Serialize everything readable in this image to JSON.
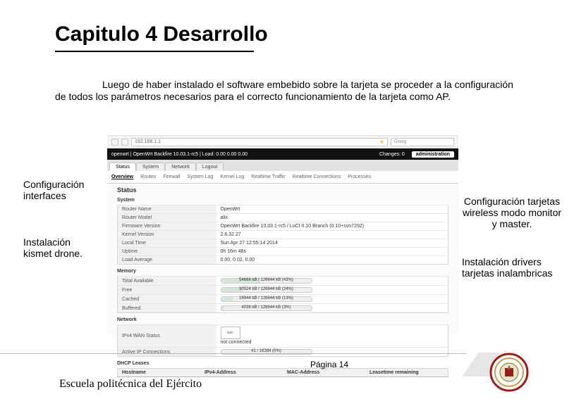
{
  "title": "Capitulo 4  Desarrollo",
  "paragraph": "Luego de haber instalado el software embebido sobre la tarjeta se proceder a la configuración de todos los parámetros necesarios para el correcto funcionamiento de la tarjeta como AP.",
  "annotations": {
    "left1": "Configuración interfaces",
    "left2": "Instalación kismet drone.",
    "right1": "Configuración tarjetas wireless modo monitor y master.",
    "right2": "Instalación drivers tarjetas inalambricas"
  },
  "browser": {
    "address": "192.168.1.1",
    "search_placeholder": "Goog"
  },
  "admin": {
    "brand": "openwrt | OpenWrt Backfire 10.03.1-rc5 | Load: 0.00 0.00 0.00",
    "changes": "Changes: 0",
    "admin_label": "administration"
  },
  "tabs": {
    "main": [
      "Status",
      "System",
      "Network",
      "Logout"
    ],
    "sub": [
      "Overview",
      "Routes",
      "Firewall",
      "System Log",
      "Kernel Log",
      "Realtime Traffic",
      "Realtime Connections",
      "Processes"
    ]
  },
  "status": {
    "heading": "Status",
    "system_heading": "System",
    "system": [
      {
        "k": "Router Name",
        "v": "OpenWrt"
      },
      {
        "k": "Router Model",
        "v": "alix"
      },
      {
        "k": "Firmware Version",
        "v": "OpenWrt Backfire 10.03.1-rc5 / LuCI 0.10 Branch (0.10+svn7292)"
      },
      {
        "k": "Kernel Version",
        "v": "2.6.32.27"
      },
      {
        "k": "Local Time",
        "v": "Sun Apr 27 12:55:14 2014"
      },
      {
        "k": "Uptime",
        "v": "0h 16m 48s"
      },
      {
        "k": "Load Average",
        "v": "0.00, 0.02, 0.00"
      }
    ],
    "memory_heading": "Memory",
    "memory": [
      {
        "k": "Total Available",
        "v": "54668 kB / 126644 kB (43%)"
      },
      {
        "k": "Free",
        "v": "30524 kB / 126644 kB (24%)"
      },
      {
        "k": "Cached",
        "v": "16944 kB / 126644 kB (13%)"
      },
      {
        "k": "Buffered",
        "v": "4036 kB / 126644 kB (3%)"
      }
    ],
    "network_heading": "Network",
    "wan_label": "IPv4 WAN Status",
    "wan_iface": "wan",
    "wan_info": "not connected",
    "conns_label": "Active IP Connections",
    "conns_value": "41 / 16384 (0%)",
    "dhcp_heading": "DHCP Leases",
    "dhcp_cols": [
      "Hostname",
      "IPv4-Address",
      "MAC-Address",
      "Leasetime remaining"
    ]
  },
  "footer": {
    "school": "Escuela politécnica del Ejército",
    "page": "Página 14"
  }
}
